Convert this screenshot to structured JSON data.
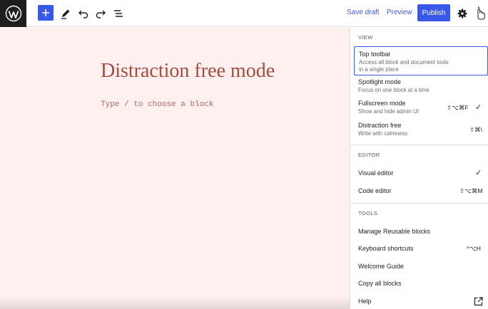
{
  "toolbar": {
    "save_draft": "Save draft",
    "preview": "Preview",
    "publish": "Publish",
    "colors": {
      "accent": "#3858e9",
      "logo_bg": "#1e1e1e"
    }
  },
  "canvas": {
    "title": "Distraction free mode",
    "placeholder": "Type / to choose a block",
    "colors": {
      "background": "#fdf0ef",
      "title": "#a54b3f"
    }
  },
  "menu": {
    "view": {
      "label": "VIEW",
      "items": [
        {
          "title": "Top toolbar",
          "desc1": "Access all block and document tools",
          "desc2": "in a single place",
          "selected": true
        },
        {
          "title": "Spotlight mode",
          "desc1": "Focus on one block at a time"
        },
        {
          "title": "Fullscreen mode",
          "desc1": "Show and hide admin UI",
          "shortcut": "⇧⌥⌘F",
          "checked": true
        },
        {
          "title": "Distraction free",
          "desc1": "Write with calmness",
          "shortcut": "⇧⌘\\"
        }
      ]
    },
    "editor": {
      "label": "EDITOR",
      "items": [
        {
          "title": "Visual editor",
          "checked": true
        },
        {
          "title": "Code editor",
          "shortcut": "⇧⌥⌘M"
        }
      ]
    },
    "tools": {
      "label": "TOOLS",
      "items": [
        {
          "title": "Manage Reusable blocks"
        },
        {
          "title": "Keyboard shortcuts",
          "shortcut": "^⌥H"
        },
        {
          "title": "Welcome Guide"
        },
        {
          "title": "Copy all blocks"
        },
        {
          "title": "Help",
          "icon": "external-link-icon"
        }
      ]
    }
  }
}
